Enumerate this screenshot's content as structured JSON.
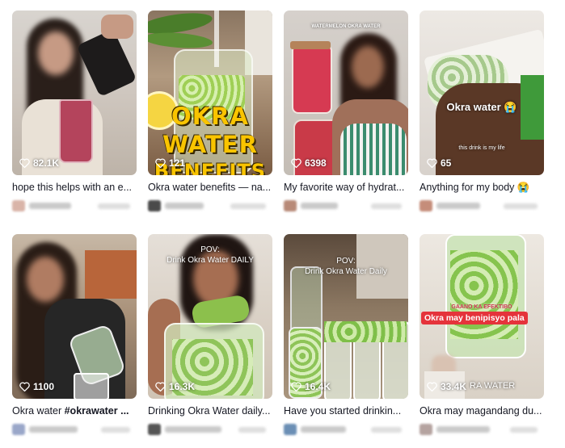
{
  "videos": [
    {
      "likes": "82.1K",
      "caption": "hope this helps with an e..."
    },
    {
      "likes": "121",
      "caption": "Okra water benefits — na...",
      "overlay": [
        "OKRA",
        "WATER",
        "BENEFITS"
      ]
    },
    {
      "likes": "6398",
      "caption": "My favorite way of hydrat...",
      "overlay": "WATERMELON OKRA WATER"
    },
    {
      "likes": "65",
      "caption": "Anything for my body 😭",
      "overlay": "Okra water 😭",
      "overlay_small": "this drink is my life"
    },
    {
      "likes": "1100",
      "caption_text": "Okra water ",
      "caption_tag": "#okrawater ..."
    },
    {
      "likes": "16.3K",
      "caption": "Drinking Okra Water daily...",
      "overlay": "POV:",
      "overlay2": "Drink Okra Water DAILY"
    },
    {
      "likes": "16.4K",
      "caption": "Have you started drinkin...",
      "overlay": "POV:",
      "overlay2": "Drink Okra Water Daily"
    },
    {
      "likes": "33.4K",
      "caption": "Okra may magandang du...",
      "overlay": "Okra may benipisyo pala",
      "overlay_bottom": "RA WATER"
    }
  ]
}
